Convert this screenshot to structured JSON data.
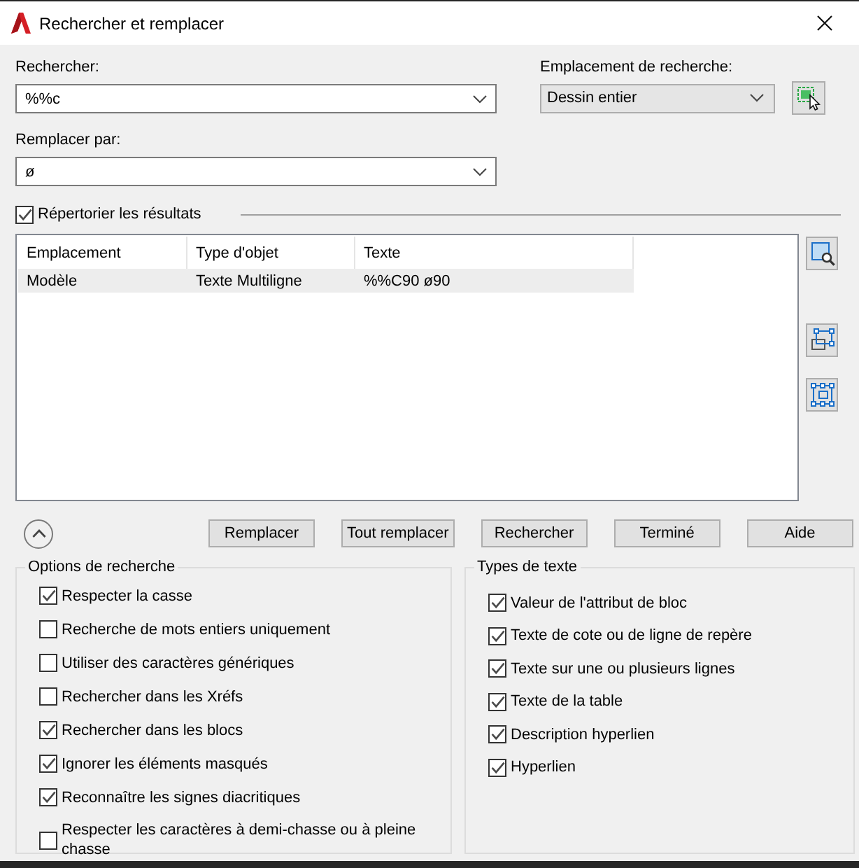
{
  "window": {
    "title": "Rechercher et remplacer"
  },
  "find": {
    "label": "Rechercher:",
    "value": "%%c"
  },
  "replace": {
    "label": "Remplacer par:",
    "value": "ø"
  },
  "search_location": {
    "label": "Emplacement de recherche:",
    "value": "Dessin entier"
  },
  "list_results": {
    "label": "Répertorier les résultats",
    "checked": true
  },
  "results_table": {
    "columns": [
      "Emplacement",
      "Type d'objet",
      "Texte"
    ],
    "rows": [
      {
        "cells": [
          "Modèle",
          "Texte Multiligne",
          "%%C90 ø90"
        ],
        "selected": true
      }
    ]
  },
  "buttons": [
    {
      "label": "Remplacer"
    },
    {
      "label": "Tout remplacer"
    },
    {
      "label": "Rechercher"
    },
    {
      "label": "Terminé"
    },
    {
      "label": "Aide"
    }
  ],
  "search_options": {
    "title": "Options de recherche",
    "items": [
      {
        "label": "Respecter la casse",
        "checked": true
      },
      {
        "label": "Recherche de mots entiers uniquement",
        "checked": false
      },
      {
        "label": "Utiliser des caractères génériques",
        "checked": false
      },
      {
        "label": "Rechercher dans les Xréfs",
        "checked": false
      },
      {
        "label": "Rechercher dans les blocs",
        "checked": true
      },
      {
        "label": "Ignorer les éléments masqués",
        "checked": true
      },
      {
        "label": "Reconnaître les signes diacritiques",
        "checked": true
      },
      {
        "label": "Respecter les caractères à demi-chasse ou à pleine chasse",
        "checked": false
      }
    ]
  },
  "text_types": {
    "title": "Types de texte",
    "items": [
      {
        "label": "Valeur de l'attribut de bloc",
        "checked": true
      },
      {
        "label": "Texte de cote ou de ligne de repère",
        "checked": true
      },
      {
        "label": "Texte sur une ou plusieurs lignes",
        "checked": true
      },
      {
        "label": "Texte de la table",
        "checked": true
      },
      {
        "label": "Description hyperlien",
        "checked": true
      },
      {
        "label": "Hyperlien",
        "checked": true
      }
    ]
  }
}
